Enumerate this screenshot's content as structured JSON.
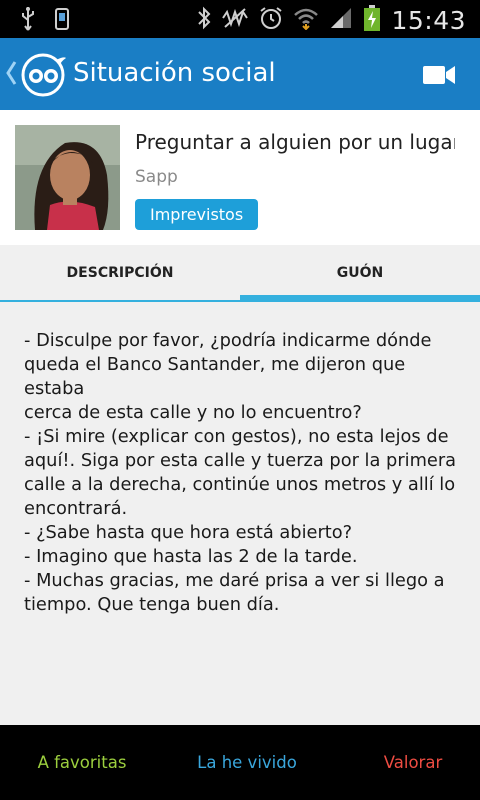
{
  "status_bar": {
    "time": "15:43",
    "icons": [
      "usb-icon",
      "sim-icon",
      "bluetooth-icon",
      "mute-icon",
      "alarm-icon",
      "wifi-icon",
      "signal-icon",
      "battery-charging-icon"
    ]
  },
  "action_bar": {
    "title": "Situación social",
    "icons": [
      "back-chevron-icon",
      "app-logo-icon",
      "video-camera-icon"
    ]
  },
  "item": {
    "title": "Preguntar a alguien por un lugar c",
    "author": "Sapp",
    "tag": "Imprevistos"
  },
  "tabs": [
    {
      "label": "DESCRIPCIÓN"
    },
    {
      "label": "GUÓN"
    }
  ],
  "script_lines": [
    "- Disculpe por favor, ¿podría indicarme dónde",
    "queda el Banco Santander, me dijeron que estaba",
    "cerca de esta calle y no lo encuentro?",
    "- ¡Si mire (explicar con gestos), no esta lejos de",
    "aquí!. Siga por esta calle y tuerza por la primera",
    "calle a la derecha, continúe unos metros y allí lo",
    "encontrará.",
    "- ¿Sabe hasta que hora está abierto?",
    "- Imagino que hasta las 2 de la tarde.",
    "- Muchas gracias, me daré prisa a ver si llego a",
    "tiempo. Que tenga buen día."
  ],
  "bottom_bar": {
    "favoritas": "A favoritas",
    "vivido": "La he vivido",
    "valorar": "Valorar"
  },
  "colors": {
    "action_bar": "#1a7ec5",
    "tag": "#1e9fd9",
    "tab_indicator": "#34b0de",
    "favoritas": "#9ccf3e",
    "vivido": "#3aa7dd",
    "valorar": "#ee4c42"
  }
}
